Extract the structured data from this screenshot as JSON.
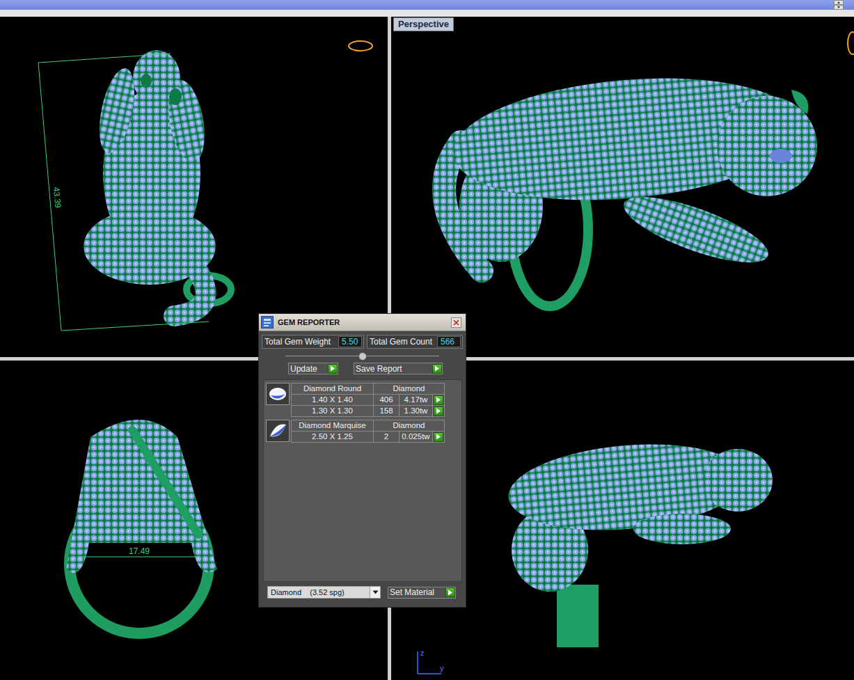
{
  "viewports": [
    {
      "kind": "top",
      "dimension": "43.39"
    },
    {
      "kind": "perspective",
      "label": "Perspective",
      "active": true
    },
    {
      "kind": "front",
      "dimension": "17.49"
    },
    {
      "kind": "right",
      "axes": [
        "z",
        "y"
      ]
    }
  ],
  "gem_reporter": {
    "title": "GEM REPORTER",
    "totals": [
      {
        "label": "Total Gem Weight",
        "value": "5.50"
      },
      {
        "label": "Total Gem Count",
        "value": "566"
      }
    ],
    "slider": {
      "level": 0.5
    },
    "buttons": [
      "Update",
      "Save Report"
    ],
    "groups": [
      {
        "kind": "round",
        "shape": "Diamond Round",
        "material": "Diamond",
        "rows": [
          {
            "size": "1.40 X 1.40",
            "count": "406",
            "weight": "4.17tw"
          },
          {
            "size": "1.30 X 1.30",
            "count": "158",
            "weight": "1.30tw"
          }
        ]
      },
      {
        "kind": "marquise",
        "shape": "Diamond Marquise",
        "material": "Diamond",
        "rows": [
          {
            "size": "2.50 X 1.25",
            "count": "2",
            "weight": "0.025tw"
          }
        ]
      }
    ],
    "material": {
      "value": "Diamond    (3.52 spg)"
    },
    "set_material": "Set Material"
  }
}
